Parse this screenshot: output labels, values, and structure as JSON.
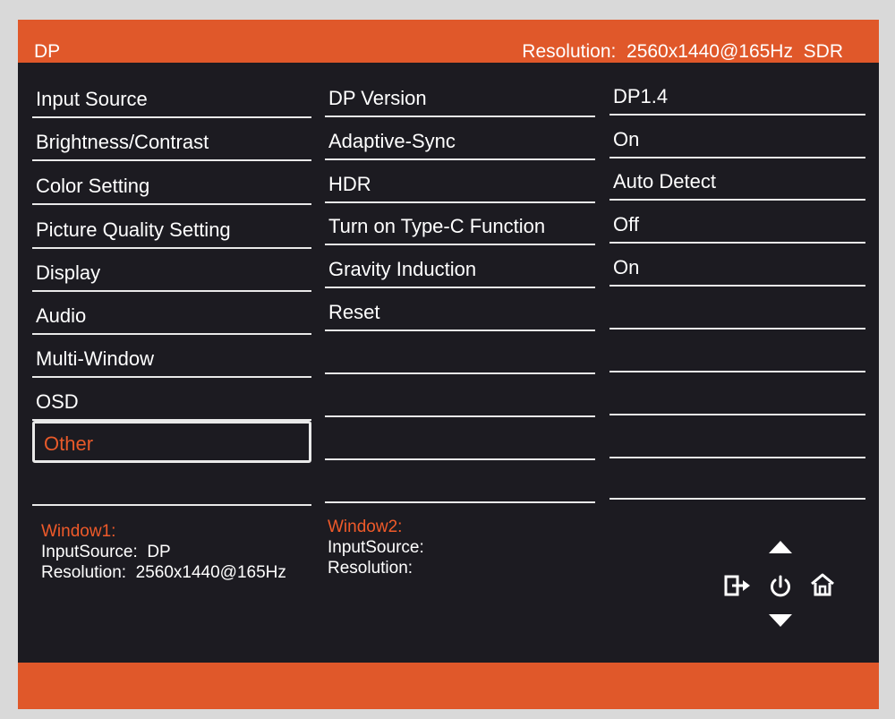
{
  "header": {
    "input": "DP",
    "resolution_label": "Resolution:",
    "resolution_value": "2560x1440@165Hz",
    "dynamic_range": "SDR"
  },
  "menu": {
    "items": [
      "Input Source",
      "Brightness/Contrast",
      "Color Setting",
      "Picture Quality Setting",
      "Display",
      "Audio",
      "Multi-Window",
      "OSD",
      "Other"
    ],
    "selected": "Other"
  },
  "submenu": {
    "items": [
      "DP Version",
      "Adaptive-Sync",
      "HDR",
      "Turn on Type-C Function",
      "Gravity Induction",
      "Reset"
    ]
  },
  "values": {
    "items": [
      "DP1.4",
      "On",
      "Auto Detect",
      "Off",
      "On"
    ]
  },
  "window1": {
    "title": "Window1:",
    "input_label": "InputSource:",
    "input_value": "DP",
    "resolution_label": "Resolution:",
    "resolution_value": "2560x1440@165Hz"
  },
  "window2": {
    "title": "Window2:",
    "input_label": "InputSource:",
    "resolution_label": "Resolution:"
  },
  "icons": {
    "up": "arrow-up-icon",
    "down": "arrow-down-icon",
    "exit": "exit-icon",
    "power": "power-icon",
    "home": "home-icon"
  },
  "colors": {
    "accent": "#e0582a",
    "background": "#1c1b21",
    "text": "#ffffff"
  }
}
